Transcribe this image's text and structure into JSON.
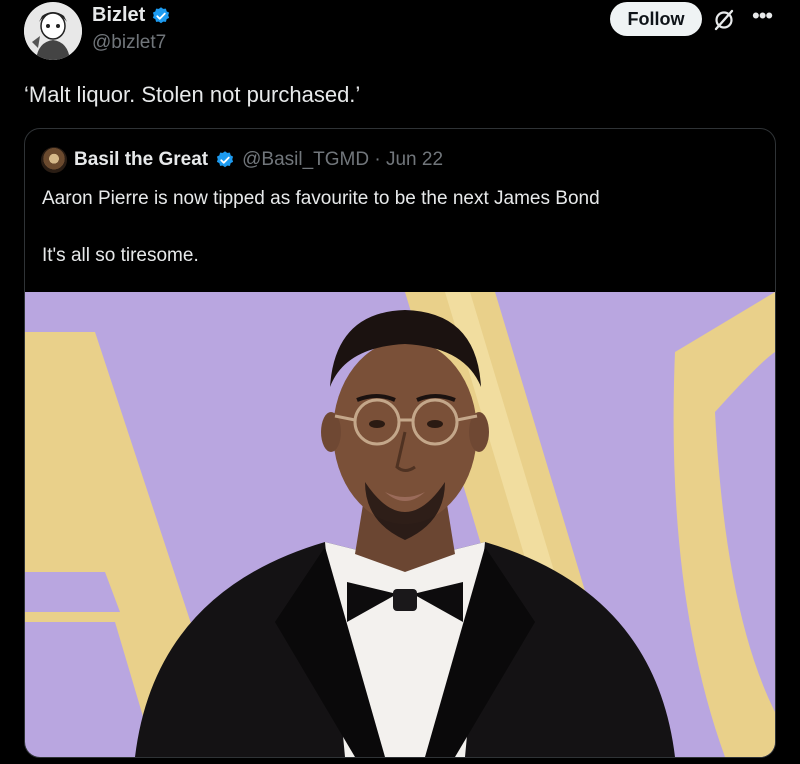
{
  "post": {
    "author_name": "Bizlet",
    "author_handle": "@bizlet7",
    "follow_label": "Follow",
    "more_label": "•••",
    "text": "‘Malt liquor. Stolen not purchased.’"
  },
  "quoted": {
    "author_name": "Basil the Great",
    "handle_date": "@Basil_TGMD · Jun 22",
    "line1": "Aaron Pierre is now tipped as favourite to be the next James Bond",
    "line2": "It's all so tiresome."
  },
  "colors": {
    "background": "#000000",
    "verified_blue": "#1d9bf0",
    "photo_backdrop": "#b9a6e0",
    "photo_gold": "#e9d08a"
  },
  "icons": {
    "verified": "verified-badge-icon",
    "grok": "grok-icon",
    "more": "more-icon"
  }
}
